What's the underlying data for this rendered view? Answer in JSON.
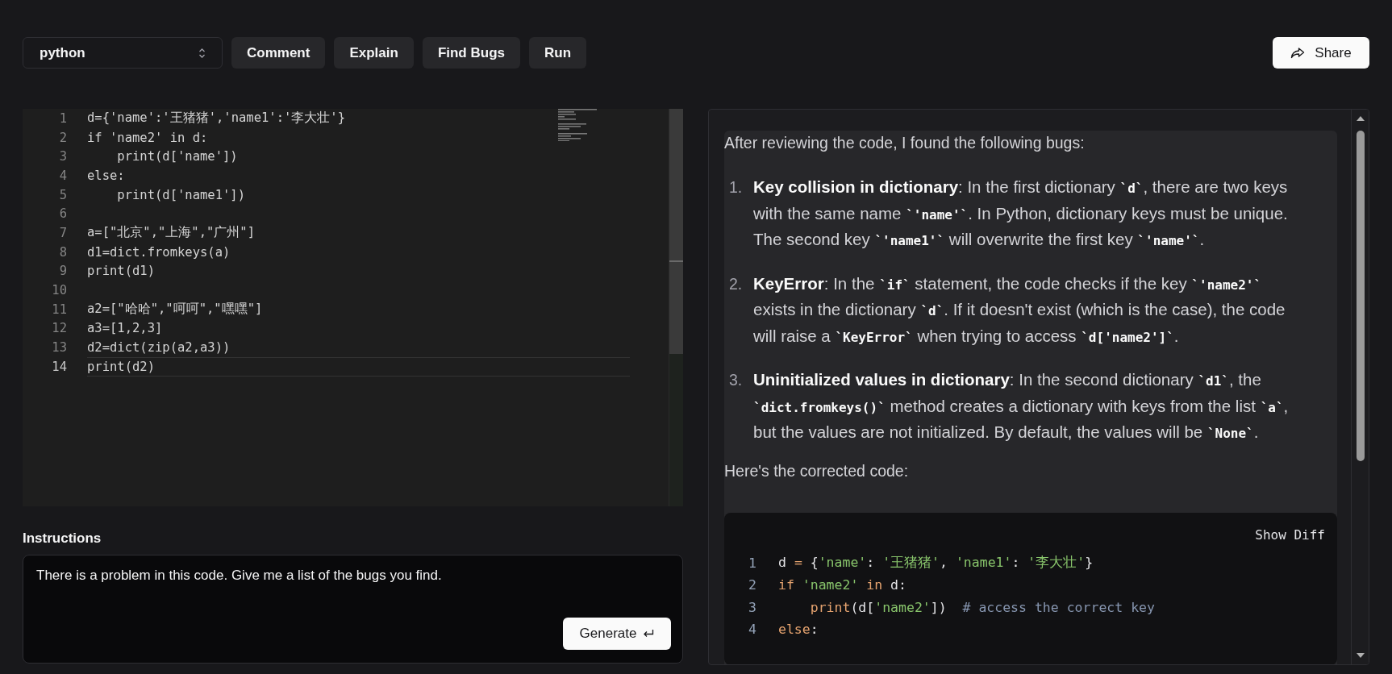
{
  "toolbar": {
    "language_select": {
      "value": "python"
    },
    "actions": [
      "Comment",
      "Explain",
      "Find Bugs",
      "Run"
    ],
    "share_button": "Share"
  },
  "editor": {
    "lines": [
      {
        "number": "1",
        "code": "d={'name':'王猪猪','name1':'李大壮'}",
        "active": false
      },
      {
        "number": "2",
        "code": "if 'name2' in d:",
        "active": false
      },
      {
        "number": "3",
        "code": "    print(d['name'])",
        "active": false
      },
      {
        "number": "4",
        "code": "else:",
        "active": false
      },
      {
        "number": "5",
        "code": "    print(d['name1'])",
        "active": false
      },
      {
        "number": "6",
        "active": false
      },
      {
        "number": "7",
        "code": "a=[\"北京\",\"上海\",\"广州\"]",
        "active": false
      },
      {
        "number": "8",
        "code": "d1=dict.fromkeys(a)",
        "active": false
      },
      {
        "number": "9",
        "code": "print(d1)",
        "active": false
      },
      {
        "number": "10",
        "active": false
      },
      {
        "number": "11",
        "code": "a2=[\"哈哈\",\"呵呵\",\"嘿嘿\"]",
        "active": false
      },
      {
        "number": "12",
        "code": "a3=[1,2,3]",
        "active": false
      },
      {
        "number": "13",
        "code": "d2=dict(zip(a2,a3))",
        "active": false
      },
      {
        "number": "14",
        "code": "print(d2)",
        "active": true
      }
    ]
  },
  "instructions": {
    "label": "Instructions",
    "value": "There is a problem in this code. Give me a list of the bugs you find.",
    "button": "Generate"
  },
  "response": {
    "intro": "After reviewing the code, I found the following bugs:",
    "items": [
      {
        "number": "1.",
        "segments": [
          {
            "kind": "bold",
            "text": "Key collision in dictionary"
          },
          {
            "kind": "text",
            "text": ": In the first dictionary "
          },
          {
            "kind": "code",
            "text": "`d`"
          },
          {
            "kind": "text",
            "text": ", there are two keys with the same name "
          },
          {
            "kind": "code",
            "text": "`'name'`"
          },
          {
            "kind": "text",
            "text": ". In Python, dictionary keys must be unique. The second key "
          },
          {
            "kind": "code",
            "text": "`'name1'`"
          },
          {
            "kind": "text",
            "text": " will overwrite the first key "
          },
          {
            "kind": "code",
            "text": "`'name'`"
          },
          {
            "kind": "text",
            "text": "."
          }
        ]
      },
      {
        "number": "2.",
        "segments": [
          {
            "kind": "bold",
            "text": "KeyError"
          },
          {
            "kind": "text",
            "text": ": In the "
          },
          {
            "kind": "code",
            "text": "`if`"
          },
          {
            "kind": "text",
            "text": " statement, the code checks if the key "
          },
          {
            "kind": "code",
            "text": "`'name2'`"
          },
          {
            "kind": "text",
            "text": " exists in the dictionary "
          },
          {
            "kind": "code",
            "text": "`d`"
          },
          {
            "kind": "text",
            "text": ". If it doesn't exist (which is the case), the code will raise a "
          },
          {
            "kind": "code",
            "text": "`KeyError`"
          },
          {
            "kind": "text",
            "text": " when trying to access "
          },
          {
            "kind": "code",
            "text": "`d['name2']`"
          },
          {
            "kind": "text",
            "text": "."
          }
        ]
      },
      {
        "number": "3.",
        "segments": [
          {
            "kind": "bold",
            "text": "Uninitialized values in dictionary"
          },
          {
            "kind": "text",
            "text": ": In the second dictionary "
          },
          {
            "kind": "code",
            "text": "`d1`"
          },
          {
            "kind": "text",
            "text": ", the "
          },
          {
            "kind": "code",
            "text": "`dict.fromkeys()`"
          },
          {
            "kind": "text",
            "text": " method creates a dictionary with keys from the list "
          },
          {
            "kind": "code",
            "text": "`a`"
          },
          {
            "kind": "text",
            "text": ", but the values are not initialized. By default, the values will be "
          },
          {
            "kind": "code",
            "text": "`None`"
          },
          {
            "kind": "text",
            "text": "."
          }
        ]
      }
    ],
    "outro": "Here's the corrected code:",
    "code_block": {
      "action": "Show Diff",
      "lines": [
        {
          "number": "1",
          "tokens": [
            {
              "kind": "plain",
              "text": "d "
            },
            {
              "kind": "op",
              "text": "="
            },
            {
              "kind": "plain",
              "text": " {"
            },
            {
              "kind": "string",
              "text": "'name'"
            },
            {
              "kind": "plain",
              "text": ": "
            },
            {
              "kind": "string",
              "text": "'王猪猪'"
            },
            {
              "kind": "plain",
              "text": ", "
            },
            {
              "kind": "string",
              "text": "'name1'"
            },
            {
              "kind": "plain",
              "text": ": "
            },
            {
              "kind": "string",
              "text": "'李大壮'"
            },
            {
              "kind": "plain",
              "text": "}"
            }
          ]
        },
        {
          "number": "2",
          "tokens": [
            {
              "kind": "keyword",
              "text": "if"
            },
            {
              "kind": "string",
              "text": " 'name2' "
            },
            {
              "kind": "keyword",
              "text": "in"
            },
            {
              "kind": "plain",
              "text": " d:"
            }
          ]
        },
        {
          "number": "3",
          "tokens": [
            {
              "kind": "keyword",
              "text": "    print"
            },
            {
              "kind": "plain",
              "text": "(d["
            },
            {
              "kind": "string",
              "text": "'name2'"
            },
            {
              "kind": "plain",
              "text": "])  "
            },
            {
              "kind": "comment",
              "text": "# access the correct key"
            }
          ]
        },
        {
          "number": "4",
          "tokens": [
            {
              "kind": "keyword",
              "text": "else"
            },
            {
              "kind": "plain",
              "text": ":"
            }
          ]
        }
      ]
    }
  }
}
